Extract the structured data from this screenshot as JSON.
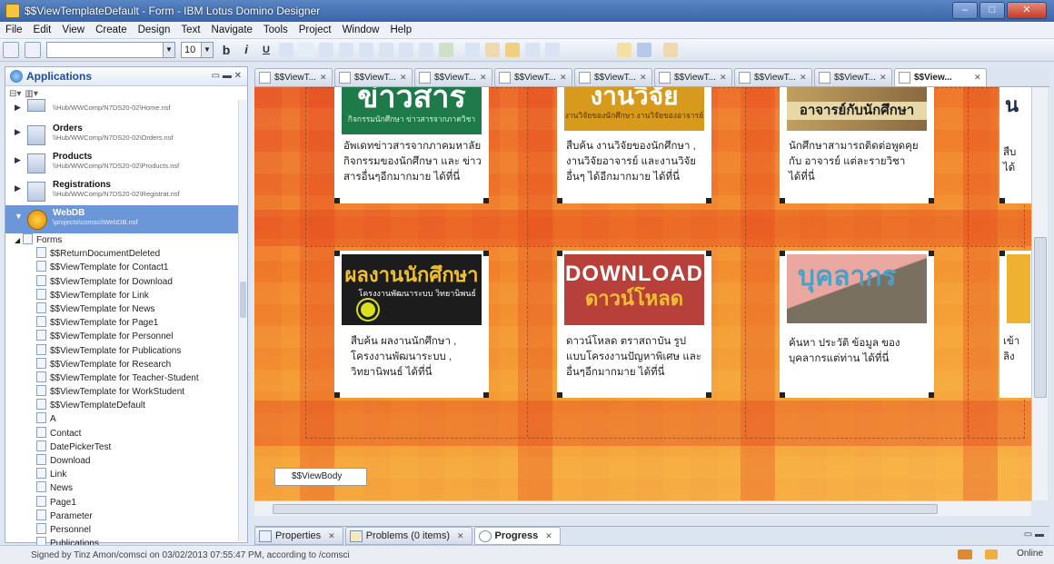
{
  "window": {
    "title": "$$ViewTemplateDefault - Form - IBM Lotus Domino Designer",
    "controls": {
      "minimize": "‒",
      "maximize": "□",
      "close": "✕"
    }
  },
  "menu": [
    "File",
    "Edit",
    "View",
    "Create",
    "Design",
    "Text",
    "Navigate",
    "Tools",
    "Project",
    "Window",
    "Help"
  ],
  "toolbar": {
    "font_size": "10",
    "bold": "b",
    "italic": "i",
    "underline": "U"
  },
  "left_panel": {
    "title": "Applications",
    "databases": [
      {
        "name": "",
        "path": "\\\\Hub/WWComp/N7DS20-02\\Home.nsf",
        "selected": false
      },
      {
        "name": "Orders",
        "path": "\\\\Hub/WWComp/N7DS20-02\\Orders.nsf",
        "selected": false
      },
      {
        "name": "Products",
        "path": "\\\\Hub/WWComp/N7DS20-02\\Products.nsf",
        "selected": false
      },
      {
        "name": "Registrations",
        "path": "\\\\Hub/WWComp/N7DS20-02\\Registrat.nsf",
        "selected": false
      },
      {
        "name": "WebDB",
        "path": "\\projects\\comsci\\WebDB.nsf",
        "selected": true
      }
    ],
    "forms_label": "Forms",
    "forms": [
      "$$ReturnDocumentDeleted",
      "$$ViewTemplate for Contact1",
      "$$ViewTemplate for Download",
      "$$ViewTemplate for Link",
      "$$ViewTemplate for News",
      "$$ViewTemplate for Page1",
      "$$ViewTemplate for Personnel",
      "$$ViewTemplate for Publications",
      "$$ViewTemplate for Research",
      "$$ViewTemplate for Teacher-Student",
      "$$ViewTemplate for WorkStudent",
      "$$ViewTemplateDefault",
      "A",
      "Contact",
      "DatePickerTest",
      "Download",
      "Link",
      "News",
      "Page1",
      "Parameter",
      "Personnel",
      "Publications"
    ]
  },
  "editor_tabs": [
    {
      "label": "$$ViewT...",
      "active": false
    },
    {
      "label": "$$ViewT...",
      "active": false
    },
    {
      "label": "$$ViewT...",
      "active": false
    },
    {
      "label": "$$ViewT...",
      "active": false
    },
    {
      "label": "$$ViewT...",
      "active": false
    },
    {
      "label": "$$ViewT...",
      "active": false
    },
    {
      "label": "$$ViewT...",
      "active": false
    },
    {
      "label": "$$ViewT...",
      "active": false
    },
    {
      "label": "$$View...",
      "active": true
    }
  ],
  "cards": {
    "news": {
      "banner": "ข่าวสาร",
      "sub": "กิจกรรมนักศึกษา ข่าวสารจากภาควิชา",
      "desc": "อัพเดทข่าวสารจากภาคมหาลัย กิจกรรมของนักศึกษา และ ข่าวสารอื่นๆอีกมากมาย ได้ที่นี่"
    },
    "research": {
      "banner": "งานวิจัย",
      "sub": "งานวิจัยของนักศึกษา งานวิจัยของอาจารย์",
      "desc": "สืบค้น งานวิจัยของนักศึกษา , งานวิจัยอาจารย์ และงานวิจัย อื่นๆ ได้อีกมากมาย ได้ที่นี่"
    },
    "teacher": {
      "banner": "อาจารย์กับนักศึกษา",
      "desc": "นักศึกษาสามารถติดต่อพูดคุย กับ อาจารย์ แต่ละรายวิชา ได้ที่นี่"
    },
    "works": {
      "banner": "ผลงานนักศึกษา",
      "sub": "โครงงานพัฒนาระบบ วิทยานิพนธ์",
      "desc": "สืบค้น ผลงานนักศึกษา , โครงงานพัฒนาระบบ , วิทยานิพนธ์ ได้ที่นี่"
    },
    "download": {
      "banner": "DOWNLOAD",
      "sub": "ดาวน์โหลด",
      "desc": "ดาวน์โหลด ตราสถาบัน รูปแบบโครงงานปัญหาพิเศษ และอื่นๆอีกมากมาย ได้ที่นี่"
    },
    "personnel": {
      "banner": "บุคลากร",
      "desc": "ค้นหา ประวัติ ข้อมูล ของ บุคลากรแต่ท่าน ได้ที่นี่"
    },
    "partial_top": {
      "banner": "น",
      "desc": "สืบ ได้"
    },
    "partial_bottom": {
      "desc": "เข้า ลิง"
    }
  },
  "view_body_label": "$$ViewBody",
  "bottom_tabs": [
    {
      "label": "Properties",
      "active": false
    },
    {
      "label": "Problems (0 items)",
      "active": false
    },
    {
      "label": "Progress",
      "active": true
    }
  ],
  "status": {
    "signature": "Signed by Tinz Amon/comsci on 03/02/2013 07:55:47 PM, according to /comsci",
    "online": "Online"
  },
  "colors": {
    "titlebar": "#3a64a8",
    "selection": "#6b97d8",
    "canvas_orange": "#ef7a2a",
    "banner_green": "#1f7a4a",
    "banner_amber": "#d79a1c",
    "banner_dark": "#1c1c1c",
    "banner_red": "#b8403a",
    "banner_pink": "#e9a7a0"
  },
  "icons": {
    "app": "lotus-app-icon",
    "applications": "globe-icon",
    "database": "database-icon",
    "form": "form-icon",
    "tab": "form-tab-icon"
  }
}
